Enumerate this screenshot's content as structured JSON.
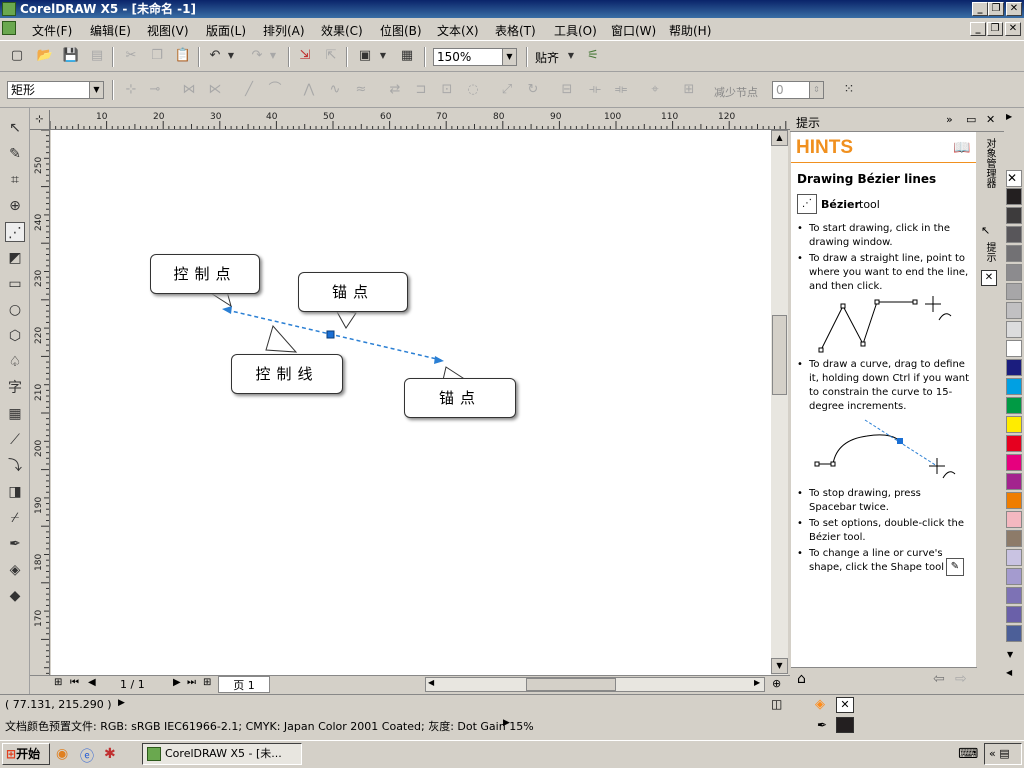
{
  "window": {
    "title": "CorelDRAW X5 - [未命名 -1]",
    "min_glyph": "_",
    "restore_glyph": "❐",
    "close_glyph": "✕"
  },
  "menu": [
    "文件(F)",
    "编辑(E)",
    "视图(V)",
    "版面(L)",
    "排列(A)",
    "效果(C)",
    "位图(B)",
    "文本(X)",
    "表格(T)",
    "工具(O)",
    "窗口(W)",
    "帮助(H)"
  ],
  "toolbar": {
    "zoom_value": "150%",
    "snap_label": "贴齐"
  },
  "property_bar": {
    "shape_select": "矩形",
    "reduce_nodes_label": "减少节点",
    "reduce_nodes_value": "0"
  },
  "ruler": {
    "h_ticks": [
      "10",
      "20",
      "30",
      "40",
      "50",
      "60",
      "70",
      "80",
      "90",
      "100",
      "110",
      "120"
    ],
    "v_ticks": [
      "250",
      "240",
      "230",
      "220",
      "210",
      "200",
      "190",
      "180",
      "170"
    ]
  },
  "canvas": {
    "callouts": {
      "control_point": "控制点",
      "anchor_top": "锚点",
      "control_line": "控制线",
      "anchor_bottom": "锚点"
    }
  },
  "page_nav": {
    "page_count": "1 / 1",
    "page_tab": "页 1"
  },
  "docker": {
    "header": "提示",
    "hints_heading": "HINTS",
    "hint_title": "Drawing Bézier lines",
    "tool_name": "Bézier",
    "tool_suffix": "tool",
    "tips": [
      "To start drawing, click in the drawing window.",
      "To draw a straight line, point to where you want to end the line, and then click.",
      "To draw a curve, drag to define it, holding down Ctrl if you want to constrain the curve to 15-degree increments.",
      "To stop drawing, press Spacebar twice.",
      "To set options, double-click the Bézier tool.",
      "To change a line or curve's shape, click the Shape tool"
    ],
    "tab_object_manager": "对象管理器",
    "tab_hints": "提示"
  },
  "palette": {
    "colors": [
      "#231f20",
      "#3d3b3c",
      "#58565a",
      "#727174",
      "#8c8b8e",
      "#a7a6a8",
      "#c1c0c2",
      "#dcdcdd",
      "#ffffff",
      "#1b1d7e",
      "#00a0e3",
      "#009a44",
      "#ffec00",
      "#e6001f",
      "#e6007e",
      "#a3238e",
      "#ef7d00",
      "#f4b8c0",
      "#8d7b69",
      "#c9c3e2",
      "#a49bcf",
      "#7d72b5",
      "#6a60a9",
      "#4c5f98"
    ]
  },
  "status": {
    "coords": "( 77.131, 215.290 )",
    "color_profile": "文档颜色预置文件: RGB: sRGB IEC61966-2.1; CMYK: Japan Color 2001 Coated; 灰度: Dot Gain 15%"
  },
  "taskbar": {
    "start_label": "开始",
    "task_item": "CorelDRAW X5 - [未..."
  }
}
